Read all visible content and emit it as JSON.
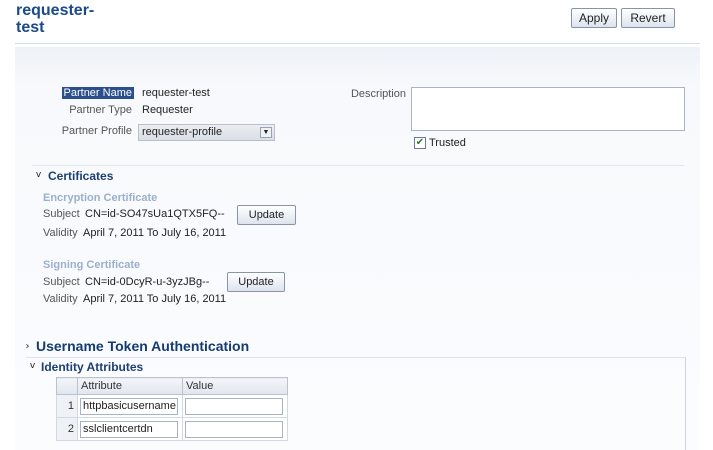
{
  "header": {
    "title": "requester-\ntest",
    "apply_label": "Apply",
    "revert_label": "Revert"
  },
  "partner": {
    "name_label": "Partner Name",
    "name_value": "requester-test",
    "type_label": "Partner Type",
    "type_value": "Requester",
    "profile_label": "Partner Profile",
    "profile_value": "requester-profile",
    "description_label": "Description",
    "description_value": "",
    "trusted_label": "Trusted",
    "trusted_checked": true
  },
  "certificates": {
    "section_label": "Certificates",
    "encryption": {
      "heading": "Encryption Certificate",
      "subject_label": "Subject",
      "subject_value": "CN=id-SO47sUa1QTX5FQ--",
      "validity_label": "Validity",
      "validity_value": "April 7, 2011 To July 16, 2011",
      "update_label": "Update"
    },
    "signing": {
      "heading": "Signing Certificate",
      "subject_label": "Subject",
      "subject_value": "CN=id-0DcyR-u-3yzJBg--",
      "validity_label": "Validity",
      "validity_value": "April 7, 2011 To July 16, 2011",
      "update_label": "Update"
    }
  },
  "username_token": {
    "section_label": "Username Token Authentication"
  },
  "identity_attributes": {
    "section_label": "Identity Attributes",
    "columns": [
      "Attribute",
      "Value"
    ],
    "rows": [
      {
        "num": "1",
        "attribute": "httpbasicusername",
        "value": ""
      },
      {
        "num": "2",
        "attribute": "sslclientcertdn",
        "value": ""
      }
    ]
  },
  "icons": {
    "collapse": "chevron-down-icon",
    "expand": "chevron-right-icon",
    "dropdown": "dropdown-arrow-icon",
    "checkmark": "checkmark-icon"
  }
}
